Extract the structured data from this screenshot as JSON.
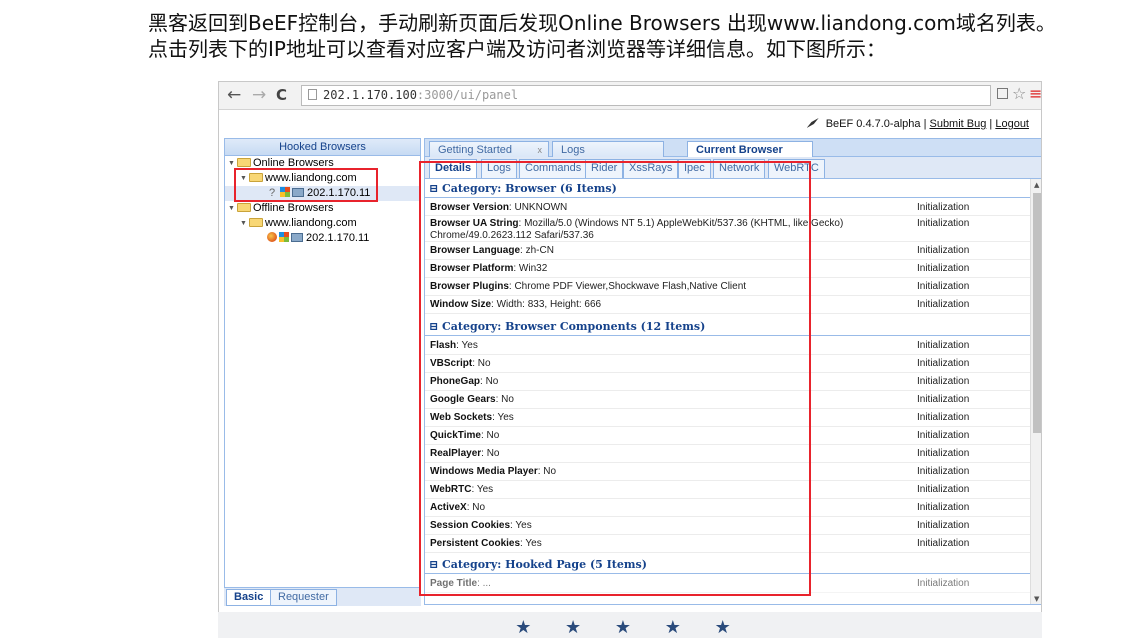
{
  "paragraph": {
    "line1": "黑客返回到BeEF控制台，手动刷新页面后发现Online Browsers 出现www.liandong.com域名列表。",
    "line2": "点击列表下的IP地址可以查看对应客户端及访问者浏览器等详细信息。如下图所示："
  },
  "browser": {
    "back": "←",
    "forward": "→",
    "reload": "C",
    "url_host": "202.1.170.100",
    "url_rest": ":3000/ui/panel",
    "ext_icon": "translate-icon",
    "star": "☆",
    "menu": "≡"
  },
  "topbar": {
    "version": "BeEF  0.4.7.0-alpha",
    "sep1": "|",
    "submit_bug": "Submit Bug",
    "sep2": "|",
    "logout": "Logout"
  },
  "hooked": {
    "title": "Hooked Browsers",
    "online": "Online Browsers",
    "online_domain": "www.liandong.com",
    "online_ip": "202.1.170.11",
    "offline": "Offline Browsers",
    "offline_domain": "www.liandong.com",
    "offline_ip": "202.1.170.11"
  },
  "bottom_tabs": {
    "basic": "Basic",
    "requester": "Requester"
  },
  "main_tabs": {
    "getting_started": "Getting Started",
    "close": "x",
    "logs": "Logs",
    "current": "Current Browser"
  },
  "sub_tabs": [
    "Details",
    "Logs",
    "Commands",
    "Rider",
    "XssRays",
    "Ipec",
    "Network",
    "WebRTC"
  ],
  "categories": {
    "browser": "Category: Browser (6 Items)",
    "components": "Category: Browser Components (12 Items)",
    "hooked": "Category: Hooked Page (5 Items)"
  },
  "rows": [
    {
      "k": "Browser Version",
      "v": ": UNKNOWN",
      "s": "Initialization"
    },
    {
      "k": "Browser UA String",
      "v": ": Mozilla/5.0 (Windows NT 5.1) AppleWebKit/537.36 (KHTML, like Gecko) Chrome/49.0.2623.112 Safari/537.36",
      "s": "Initialization"
    },
    {
      "k": "Browser Language",
      "v": ": zh-CN",
      "s": "Initialization"
    },
    {
      "k": "Browser Platform",
      "v": ": Win32",
      "s": "Initialization"
    },
    {
      "k": "Browser Plugins",
      "v": ": Chrome PDF Viewer,Shockwave Flash,Native Client",
      "s": "Initialization"
    },
    {
      "k": "Window Size",
      "v": ": Width: 833, Height: 666",
      "s": "Initialization"
    },
    {
      "k": "Flash",
      "v": ": Yes",
      "s": "Initialization"
    },
    {
      "k": "VBScript",
      "v": ": No",
      "s": "Initialization"
    },
    {
      "k": "PhoneGap",
      "v": ": No",
      "s": "Initialization"
    },
    {
      "k": "Google Gears",
      "v": ": No",
      "s": "Initialization"
    },
    {
      "k": "Web Sockets",
      "v": ": Yes",
      "s": "Initialization"
    },
    {
      "k": "QuickTime",
      "v": ": No",
      "s": "Initialization"
    },
    {
      "k": "RealPlayer",
      "v": ": No",
      "s": "Initialization"
    },
    {
      "k": "Windows Media Player",
      "v": ": No",
      "s": "Initialization"
    },
    {
      "k": "WebRTC",
      "v": ": Yes",
      "s": "Initialization"
    },
    {
      "k": "ActiveX",
      "v": ": No",
      "s": "Initialization"
    },
    {
      "k": "Session Cookies",
      "v": ": Yes",
      "s": "Initialization"
    },
    {
      "k": "Persistent Cookies",
      "v": ": Yes",
      "s": "Initialization"
    },
    {
      "k": "Page Title",
      "v": ": ...",
      "s": "Initialization"
    }
  ],
  "footer_stars": "★ ★ ★ ★ ★",
  "colors": {
    "highlight_box": "#e8232c",
    "ext_panel_border": "#99bbe8",
    "ext_header_text": "#15428b"
  }
}
